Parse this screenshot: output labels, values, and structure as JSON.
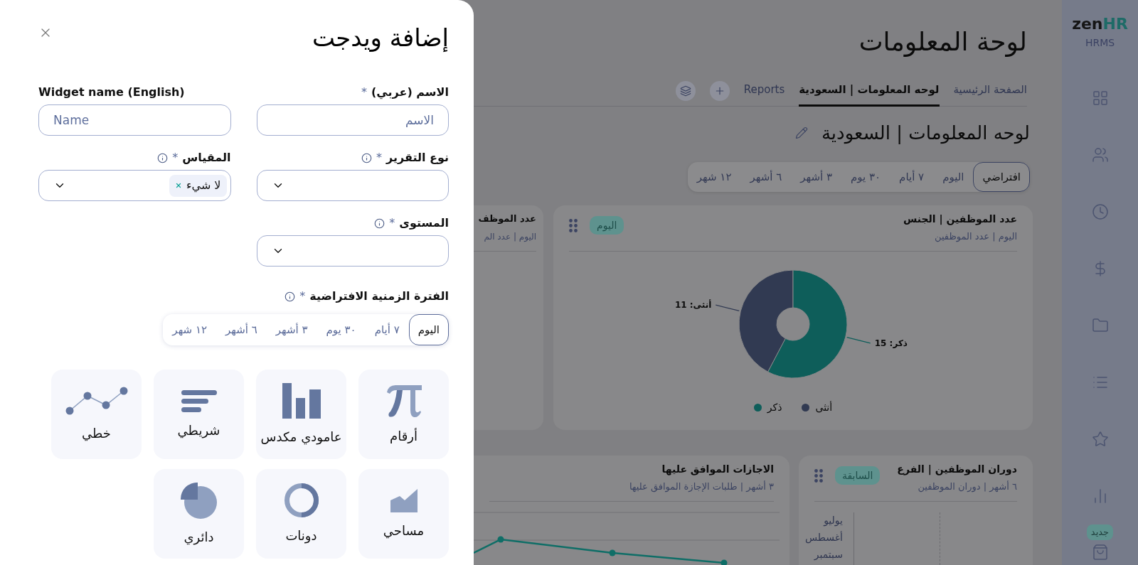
{
  "drawer": {
    "title": "إضافة ويدجت",
    "required_mark": "*",
    "fields": [
      {
        "kind": "text",
        "label": "الاسم (عربي)",
        "required": true,
        "info": false,
        "placeholder": "الاسم"
      },
      {
        "kind": "text",
        "label": "Widget name (English)",
        "required": false,
        "info": false,
        "placeholder": "Name"
      },
      {
        "kind": "select",
        "label": "نوع التقرير",
        "required": true,
        "info": true
      },
      {
        "kind": "select",
        "label": "المقياس",
        "required": true,
        "info": true,
        "chips": [
          "لا شيء"
        ]
      },
      {
        "kind": "select",
        "label": "المستوى",
        "required": true,
        "info": true
      }
    ],
    "period": {
      "label": "الفترة الزمنية الافتراضية",
      "required": true,
      "info": true,
      "options": [
        {
          "label": "اليوم",
          "selected": true
        },
        {
          "label": "٧ أيام",
          "selected": false
        },
        {
          "label": "٣٠ يوم",
          "selected": false
        },
        {
          "label": "٣ أشهر",
          "selected": false
        },
        {
          "label": "٦ أشهر",
          "selected": false
        },
        {
          "label": "١٢ شهر",
          "selected": false
        }
      ]
    },
    "chart_types": [
      {
        "kind": "numbers",
        "label": "أرقام"
      },
      {
        "kind": "stacked_column",
        "label": "عامودي مكدس"
      },
      {
        "kind": "bar",
        "label": "شريطي"
      },
      {
        "kind": "line",
        "label": "خطي"
      },
      {
        "kind": "area",
        "label": "مساحي"
      },
      {
        "kind": "donut",
        "label": "دونات"
      },
      {
        "kind": "pie",
        "label": "دائري"
      }
    ]
  },
  "sidebar": {
    "logo": {
      "word": "zen",
      "accent": "HR",
      "subtitle": "HRMS"
    },
    "new_badge": "جديد"
  },
  "page": {
    "title": "لوحة المعلومات",
    "tabs": [
      {
        "label": "الصفحة الرئيسية",
        "selected": false
      },
      {
        "label": "لوحه المعلومات | السعودية",
        "selected": true
      },
      {
        "label": "Reports",
        "selected": false
      }
    ],
    "heading": "لوحه المعلومات | السعودية",
    "filters": [
      {
        "label": "افتراضي",
        "selected": true
      },
      {
        "label": "اليوم",
        "selected": false
      },
      {
        "label": "٧ أيام",
        "selected": false
      },
      {
        "label": "٣٠ يوم",
        "selected": false
      },
      {
        "label": "٣ أشهر",
        "selected": false
      },
      {
        "label": "٦ أشهر",
        "selected": false
      },
      {
        "label": "١٢ شهر",
        "selected": false
      }
    ],
    "cards": [
      {
        "kind": "donut",
        "title": "عدد الموظفين | الجنس",
        "subtitle": "اليوم | عدد الموظفين",
        "badge": "اليوم",
        "chart_data": {
          "type": "donut",
          "categories": [
            "أنثى",
            "ذكر"
          ],
          "values": [
            11,
            15
          ],
          "colors": [
            "#313a52",
            "#0e5e5a"
          ],
          "value_labels": [
            "أنثى: 11",
            "ذكر: 15"
          ],
          "legend": "bottom"
        }
      },
      {
        "kind": "partial",
        "title": "عدد الموظف",
        "subtitle": "اليوم | عدد الم"
      },
      {
        "kind": "bar_rows",
        "title": "دوران الموظفين | الفرع",
        "subtitle": "٦ أشهر | دوران الموظفين",
        "badge": "السابقة",
        "axis_labels": [
          "يوليو",
          "أغسطس",
          "سبتمبر"
        ]
      },
      {
        "kind": "line",
        "title": "الاجازات الموافق عليها",
        "subtitle": "٣ أشهر | طلبات الإجازة الموافق عليها"
      }
    ]
  }
}
